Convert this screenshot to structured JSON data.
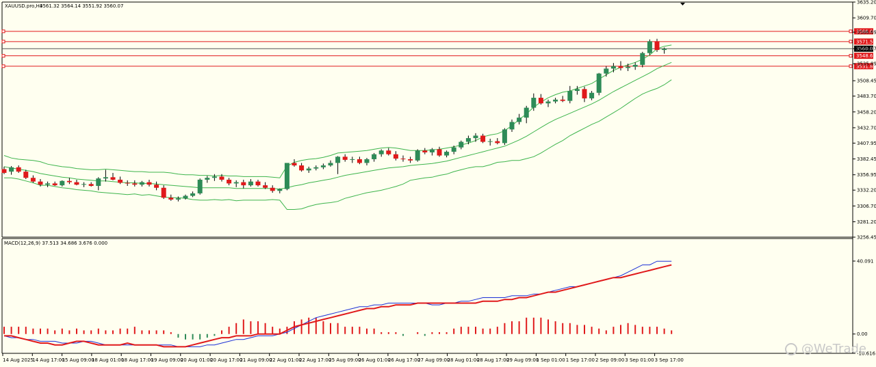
{
  "colors": {
    "background": "#fffff0",
    "bull_candle": "#2e8b57",
    "bear_candle": "#e0191b",
    "bollinger": "#3cb44b",
    "level_line": "#e0191b",
    "price_line": "#555555",
    "macd_line": "#e0191b",
    "signal_line": "#1a2fd6",
    "histogram": "#e0191b"
  },
  "header": {
    "symbol_text": "XAUUSD.pro,H4",
    "ohlc_text": "3561.32 3564.14 3551.92 3560.07"
  },
  "indicator": {
    "label": "MACD(12,26,9) 37.513 34.686 3.676 0.000"
  },
  "watermark": {
    "text": "@WeTrade",
    "icon": "wetrade-logo-icon"
  },
  "chart_data": [
    {
      "type": "candlestick",
      "title": "XAUUSD.pro,H4",
      "ylim": [
        3256.45,
        3635.2
      ],
      "y_ticks": [
        "3635.20",
        "3609.70",
        "3586.69",
        "3560.07",
        "3535.89",
        "3508.45",
        "3483.70",
        "3458.20",
        "3432.70",
        "3407.95",
        "3382.45",
        "3356.95",
        "3332.20",
        "3306.70",
        "3281.20",
        "3256.45"
      ],
      "x_ticks": [
        "14 Aug 2025",
        "14 Aug 17:00",
        "15 Aug 09:00",
        "18 Aug 01:00",
        "18 Aug 17:00",
        "19 Aug 09:00",
        "20 Aug 01:00",
        "20 Aug 17:00",
        "21 Aug 09:00",
        "22 Aug 01:00",
        "22 Aug 17:00",
        "25 Aug 09:00",
        "26 Aug 01:00",
        "26 Aug 17:00",
        "27 Aug 09:00",
        "28 Aug 01:00",
        "28 Aug 17:00",
        "29 Aug 09:00",
        "1 Sep 01:00",
        "1 Sep 17:00",
        "2 Sep 09:00",
        "3 Sep 01:00",
        "3 Sep 17:00"
      ],
      "level_lines": [
        {
          "price": 3588.04,
          "label": "3588.04"
        },
        {
          "price": 3571.53,
          "label": "3571.53"
        },
        {
          "price": 3548.61,
          "label": "3548.61"
        },
        {
          "price": 3531.89,
          "label": "3531.89"
        }
      ],
      "current_price": {
        "price": 3560.07,
        "label": "3560.07"
      },
      "candles": [
        [
          3366,
          3370,
          3358,
          3360
        ],
        [
          3362,
          3371,
          3357,
          3369
        ],
        [
          3369,
          3372,
          3360,
          3362
        ],
        [
          3362,
          3365,
          3350,
          3352
        ],
        [
          3352,
          3356,
          3344,
          3346
        ],
        [
          3346,
          3350,
          3338,
          3341
        ],
        [
          3341,
          3346,
          3337,
          3343
        ],
        [
          3343,
          3346,
          3339,
          3340
        ],
        [
          3340,
          3348,
          3338,
          3347
        ],
        [
          3347,
          3352,
          3342,
          3345
        ],
        [
          3345,
          3349,
          3340,
          3341
        ],
        [
          3341,
          3345,
          3337,
          3342
        ],
        [
          3342,
          3345,
          3338,
          3339
        ],
        [
          3339,
          3353,
          3332,
          3351
        ],
        [
          3351,
          3365,
          3346,
          3353
        ],
        [
          3353,
          3360,
          3348,
          3349
        ],
        [
          3349,
          3354,
          3342,
          3344
        ],
        [
          3344,
          3348,
          3339,
          3343
        ],
        [
          3343,
          3348,
          3338,
          3341
        ],
        [
          3341,
          3347,
          3338,
          3345
        ],
        [
          3345,
          3349,
          3338,
          3341
        ],
        [
          3341,
          3346,
          3332,
          3336
        ],
        [
          3336,
          3340,
          3318,
          3320
        ],
        [
          3320,
          3325,
          3315,
          3317
        ],
        [
          3317,
          3322,
          3314,
          3319
        ],
        [
          3319,
          3325,
          3317,
          3323
        ],
        [
          3323,
          3330,
          3321,
          3327
        ],
        [
          3327,
          3351,
          3325,
          3349
        ],
        [
          3349,
          3355,
          3344,
          3352
        ],
        [
          3352,
          3358,
          3347,
          3354
        ],
        [
          3354,
          3358,
          3346,
          3349
        ],
        [
          3349,
          3352,
          3340,
          3343
        ],
        [
          3343,
          3348,
          3337,
          3345
        ],
        [
          3345,
          3349,
          3335,
          3340
        ],
        [
          3340,
          3350,
          3338,
          3346
        ],
        [
          3346,
          3349,
          3338,
          3340
        ],
        [
          3340,
          3345,
          3334,
          3336
        ],
        [
          3336,
          3340,
          3328,
          3331
        ],
        [
          3331,
          3335,
          3327,
          3334
        ],
        [
          3334,
          3368,
          3332,
          3376
        ],
        [
          3376,
          3382,
          3370,
          3372
        ],
        [
          3372,
          3376,
          3362,
          3364
        ],
        [
          3364,
          3370,
          3360,
          3367
        ],
        [
          3367,
          3372,
          3364,
          3369
        ],
        [
          3369,
          3375,
          3366,
          3372
        ],
        [
          3372,
          3380,
          3370,
          3376
        ],
        [
          3376,
          3387,
          3358,
          3386
        ],
        [
          3386,
          3390,
          3378,
          3381
        ],
        [
          3381,
          3386,
          3376,
          3382
        ],
        [
          3382,
          3386,
          3374,
          3376
        ],
        [
          3376,
          3384,
          3372,
          3382
        ],
        [
          3382,
          3392,
          3378,
          3390
        ],
        [
          3390,
          3398,
          3386,
          3396
        ],
        [
          3396,
          3400,
          3388,
          3390
        ],
        [
          3390,
          3395,
          3380,
          3383
        ],
        [
          3383,
          3388,
          3378,
          3382
        ],
        [
          3382,
          3386,
          3376,
          3380
        ],
        [
          3380,
          3398,
          3378,
          3396
        ],
        [
          3396,
          3400,
          3390,
          3393
        ],
        [
          3393,
          3400,
          3388,
          3398
        ],
        [
          3398,
          3402,
          3386,
          3388
        ],
        [
          3388,
          3396,
          3385,
          3394
        ],
        [
          3394,
          3404,
          3390,
          3401
        ],
        [
          3401,
          3412,
          3398,
          3410
        ],
        [
          3410,
          3420,
          3406,
          3416
        ],
        [
          3416,
          3424,
          3410,
          3420
        ],
        [
          3420,
          3423,
          3408,
          3410
        ],
        [
          3410,
          3415,
          3404,
          3411
        ],
        [
          3411,
          3416,
          3406,
          3408
        ],
        [
          3408,
          3432,
          3405,
          3430
        ],
        [
          3430,
          3446,
          3426,
          3442
        ],
        [
          3442,
          3455,
          3438,
          3449
        ],
        [
          3449,
          3468,
          3440,
          3465
        ],
        [
          3465,
          3488,
          3460,
          3481
        ],
        [
          3481,
          3487,
          3470,
          3472
        ],
        [
          3472,
          3478,
          3466,
          3475
        ],
        [
          3475,
          3481,
          3472,
          3478
        ],
        [
          3478,
          3484,
          3474,
          3476
        ],
        [
          3476,
          3500,
          3472,
          3492
        ],
        [
          3492,
          3500,
          3486,
          3495
        ],
        [
          3495,
          3499,
          3474,
          3480
        ],
        [
          3480,
          3492,
          3477,
          3489
        ],
        [
          3489,
          3521,
          3485,
          3520
        ],
        [
          3520,
          3532,
          3515,
          3528
        ],
        [
          3528,
          3537,
          3522,
          3532
        ],
        [
          3532,
          3540,
          3525,
          3529
        ],
        [
          3529,
          3536,
          3524,
          3531
        ],
        [
          3531,
          3538,
          3526,
          3534
        ],
        [
          3534,
          3555,
          3530,
          3553
        ],
        [
          3553,
          3575,
          3550,
          3572
        ],
        [
          3572,
          3576,
          3555,
          3558
        ],
        [
          3558,
          3562,
          3552,
          3560
        ]
      ],
      "bollinger": {
        "upper": [
          3388,
          3384,
          3382,
          3381,
          3380,
          3378,
          3374,
          3372,
          3370,
          3369,
          3367,
          3366,
          3365,
          3365,
          3366,
          3365,
          3364,
          3363,
          3362,
          3362,
          3361,
          3361,
          3361,
          3360,
          3358,
          3357,
          3357,
          3356,
          3356,
          3355,
          3356,
          3355,
          3355,
          3354,
          3354,
          3354,
          3354,
          3353,
          3352,
          3371,
          3377,
          3380,
          3382,
          3383,
          3385,
          3388,
          3392,
          3393,
          3394,
          3395,
          3396,
          3398,
          3400,
          3401,
          3400,
          3398,
          3396,
          3396,
          3396,
          3397,
          3398,
          3400,
          3402,
          3405,
          3408,
          3412,
          3418,
          3421,
          3423,
          3428,
          3436,
          3446,
          3455,
          3466,
          3474,
          3481,
          3486,
          3490,
          3492,
          3496,
          3500,
          3504,
          3511,
          3518,
          3525,
          3530,
          3534,
          3538,
          3543,
          3550,
          3560,
          3564,
          3566
        ],
        "middle": [
          3370,
          3368,
          3366,
          3364,
          3362,
          3359,
          3357,
          3355,
          3353,
          3352,
          3350,
          3349,
          3348,
          3347,
          3347,
          3346,
          3345,
          3344,
          3344,
          3343,
          3343,
          3342,
          3341,
          3340,
          3339,
          3338,
          3337,
          3336,
          3336,
          3336,
          3336,
          3336,
          3335,
          3335,
          3335,
          3335,
          3335,
          3335,
          3334,
          3336,
          3339,
          3341,
          3344,
          3346,
          3348,
          3350,
          3353,
          3356,
          3358,
          3360,
          3362,
          3364,
          3366,
          3368,
          3369,
          3370,
          3372,
          3373,
          3374,
          3375,
          3377,
          3379,
          3382,
          3385,
          3388,
          3391,
          3394,
          3397,
          3400,
          3403,
          3408,
          3413,
          3419,
          3426,
          3433,
          3440,
          3446,
          3451,
          3456,
          3461,
          3466,
          3471,
          3477,
          3484,
          3491,
          3497,
          3503,
          3509,
          3515,
          3521,
          3528,
          3533,
          3538
        ],
        "lower": [
          3352,
          3352,
          3350,
          3347,
          3344,
          3340,
          3340,
          3338,
          3336,
          3335,
          3333,
          3332,
          3331,
          3329,
          3328,
          3327,
          3326,
          3325,
          3326,
          3324,
          3325,
          3323,
          3321,
          3320,
          3320,
          3319,
          3317,
          3316,
          3316,
          3317,
          3316,
          3317,
          3315,
          3316,
          3316,
          3316,
          3316,
          3317,
          3316,
          3301,
          3301,
          3302,
          3306,
          3309,
          3311,
          3312,
          3314,
          3319,
          3322,
          3325,
          3328,
          3330,
          3332,
          3335,
          3338,
          3342,
          3348,
          3350,
          3352,
          3353,
          3356,
          3358,
          3362,
          3365,
          3368,
          3370,
          3370,
          3373,
          3377,
          3378,
          3380,
          3380,
          3383,
          3386,
          3392,
          3399,
          3406,
          3412,
          3420,
          3426,
          3432,
          3438,
          3443,
          3450,
          3457,
          3464,
          3472,
          3480,
          3487,
          3492,
          3496,
          3502,
          3510
        ]
      }
    },
    {
      "type": "line",
      "title": "MACD(12,26,9) 37.513 34.686 3.676 0.000",
      "ylim": [
        -10.616,
        40.091
      ],
      "y_ticks": [
        "40.091",
        "0.00",
        "-10.616"
      ],
      "series": [
        {
          "name": "MACD",
          "values": [
            -1,
            -1,
            -2,
            -3,
            -4,
            -5,
            -5,
            -6,
            -6,
            -5,
            -4,
            -4,
            -5,
            -6,
            -6,
            -6,
            -6,
            -5,
            -6,
            -6,
            -6,
            -6,
            -7,
            -7,
            -7,
            -7,
            -6,
            -5,
            -4,
            -3,
            -2,
            -2,
            -1,
            -1,
            -1,
            0,
            0,
            0,
            0,
            2,
            4,
            5,
            6,
            7,
            8,
            9,
            10,
            11,
            12,
            13,
            14,
            14,
            15,
            15,
            16,
            16,
            16,
            17,
            17,
            17,
            17,
            17,
            17,
            17,
            17,
            17,
            18,
            18,
            18,
            19,
            19,
            20,
            20,
            21,
            22,
            23,
            23,
            24,
            25,
            26,
            27,
            28,
            29,
            30,
            31,
            31,
            32,
            33,
            34,
            35,
            36,
            37,
            38
          ]
        },
        {
          "name": "Signal",
          "values": [
            -1,
            -2,
            -2,
            -3,
            -3,
            -4,
            -4,
            -4,
            -5,
            -5,
            -5,
            -4,
            -4,
            -5,
            -6,
            -6,
            -6,
            -6,
            -6,
            -6,
            -6,
            -6,
            -6,
            -6,
            -7,
            -7,
            -7,
            -7,
            -6,
            -6,
            -5,
            -4,
            -3,
            -3,
            -2,
            -1,
            -1,
            -1,
            0,
            1,
            3,
            5,
            7,
            9,
            10,
            11,
            12,
            13,
            14,
            15,
            15,
            16,
            16,
            17,
            17,
            17,
            17,
            17,
            17,
            16,
            16,
            17,
            17,
            18,
            18,
            19,
            20,
            20,
            20,
            20,
            21,
            21,
            21,
            22,
            22,
            23,
            24,
            25,
            26,
            26,
            27,
            28,
            29,
            30,
            31,
            32,
            34,
            36,
            38,
            38,
            40,
            40,
            40
          ]
        },
        {
          "name": "Histogram",
          "values": [
            4,
            4,
            4,
            4,
            3,
            3,
            3,
            2,
            3,
            2,
            3,
            2,
            2,
            3,
            2,
            2,
            3,
            3,
            4,
            2,
            2,
            2,
            2,
            1,
            -2,
            -3,
            -3,
            -3,
            -2,
            -1,
            2,
            4,
            6,
            8,
            7,
            7,
            6,
            4,
            3,
            4,
            7,
            8,
            9,
            9,
            7,
            6,
            6,
            4,
            4,
            4,
            3,
            3,
            1,
            1,
            1,
            -1,
            0,
            1,
            -1,
            1,
            1,
            1,
            3,
            4,
            4,
            4,
            3,
            3,
            4,
            6,
            7,
            7,
            9,
            9,
            9,
            8,
            7,
            6,
            6,
            5,
            5,
            4,
            3,
            2,
            4,
            5,
            6,
            5,
            4,
            4,
            4,
            3,
            2
          ]
        }
      ]
    }
  ]
}
